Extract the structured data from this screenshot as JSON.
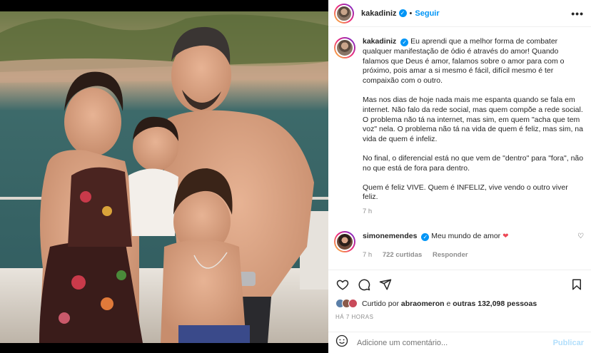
{
  "post": {
    "username": "kakadiniz",
    "follow_label": "Seguir",
    "dot": "•",
    "more": "•••"
  },
  "caption": {
    "username": "kakadiniz",
    "paragraphs": [
      "Eu aprendi que a melhor forma de combater qualquer manifestação de ódio é através do amor! Quando falamos que Deus é amor, falamos sobre o amor para com o próximo, pois amar a si mesmo é fácil, difícil mesmo é ter compaixão com o outro.",
      "Mas nos dias de hoje nada mais me espanta quando se fala em internet. Não falo da rede social, mas quem compõe a rede social. O problema não tá na internet, mas sim, em quem \"acha que tem voz\" nela. O problema não tá na vida de quem é feliz, mas sim, na vida de quem é infeliz.",
      "No final, o diferencial está no que vem de \"dentro\" para \"fora\", não no que está de fora para dentro.",
      "Quem é feliz VIVE. Quem é INFELIZ, vive vendo o outro viver feliz."
    ],
    "time": "7 h"
  },
  "comment": {
    "username": "simonemendes",
    "text": "Meu mundo de amor",
    "time": "7 h",
    "likes": "722 curtidas",
    "reply": "Responder"
  },
  "likes": {
    "prefix": "Curtido por",
    "user": "abraomeron",
    "middle": "e",
    "others": "outras 132,098 pessoas"
  },
  "ago": "HÁ 7 HORAS",
  "add_comment": {
    "placeholder": "Adicione um comentário...",
    "publish": "Publicar"
  },
  "colors": {
    "link_blue": "#0095f6",
    "heart_red": "#ed4956",
    "muted": "#8e8e8e"
  },
  "icons": [
    "verified-icon",
    "more-icon",
    "heart-icon",
    "comment-icon",
    "share-icon",
    "bookmark-icon",
    "emoji-icon"
  ]
}
